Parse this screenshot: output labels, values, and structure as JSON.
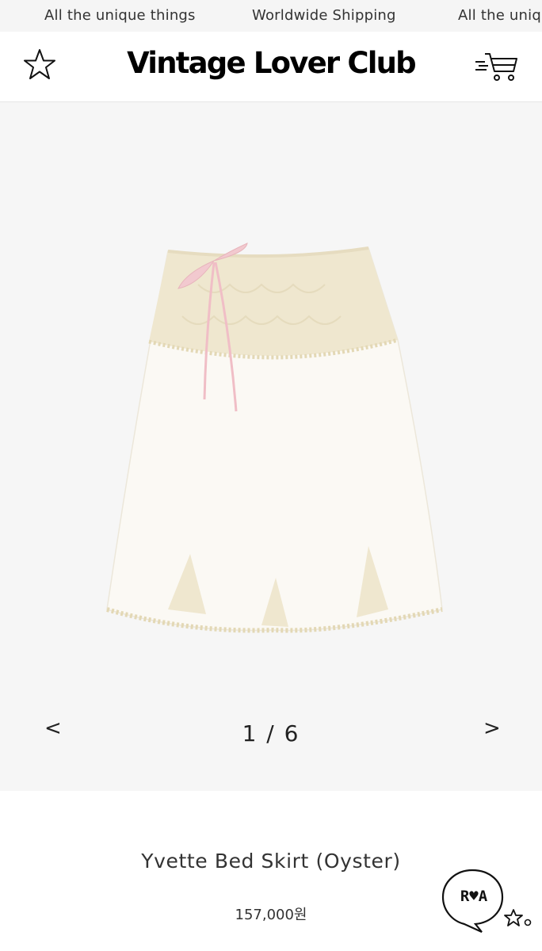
{
  "announcement": {
    "messages": [
      "All the unique things",
      "Worldwide Shipping",
      "All the uniqu"
    ]
  },
  "header": {
    "logo": "Vintage Lover Club",
    "left_icon": "star-icon",
    "right_icon": "cart-icon"
  },
  "gallery": {
    "prev": "<",
    "next": ">",
    "counter": "1 / 6",
    "background": "#f6f6f6"
  },
  "product": {
    "title": "Yvette Bed Skirt (Oyster)",
    "price": "157,000원"
  },
  "chat_badge": {
    "label": "R♥A",
    "icon": "chat-bubble-icon"
  }
}
